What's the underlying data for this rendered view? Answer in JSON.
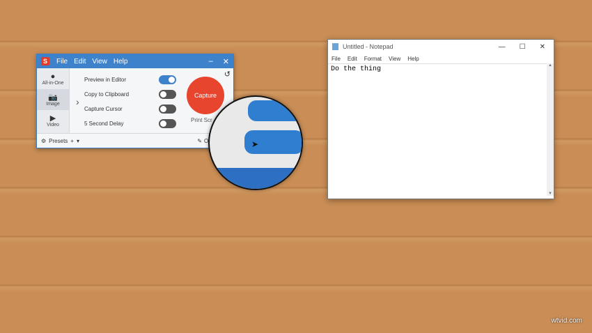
{
  "snagit": {
    "logo": "S",
    "menu": [
      "File",
      "Edit",
      "View",
      "Help"
    ],
    "window_buttons": [
      "–",
      "✕"
    ],
    "modes": [
      {
        "label": "All-in-One",
        "icon": "●"
      },
      {
        "label": "Image",
        "icon": "📷"
      },
      {
        "label": "Video",
        "icon": "▶"
      }
    ],
    "options": [
      {
        "label": "Preview in Editor",
        "on": true
      },
      {
        "label": "Copy to Clipboard",
        "on": false
      },
      {
        "label": "Capture Cursor",
        "on": false
      },
      {
        "label": "5 Second Delay",
        "on": false
      }
    ],
    "capture_label": "Capture",
    "print_screen": "Print Scr",
    "presets": "Presets",
    "add": "+",
    "options_link": "Op  or"
  },
  "notepad": {
    "title": "Untitled - Notepad",
    "menu": [
      "File",
      "Edit",
      "Format",
      "View",
      "Help"
    ],
    "window_buttons": [
      "—",
      "☐",
      "✕"
    ],
    "content": "Do the thing"
  },
  "watermark": "wtvid.com",
  "colors": {
    "accent": "#3f82cc",
    "capture": "#e8452f"
  }
}
